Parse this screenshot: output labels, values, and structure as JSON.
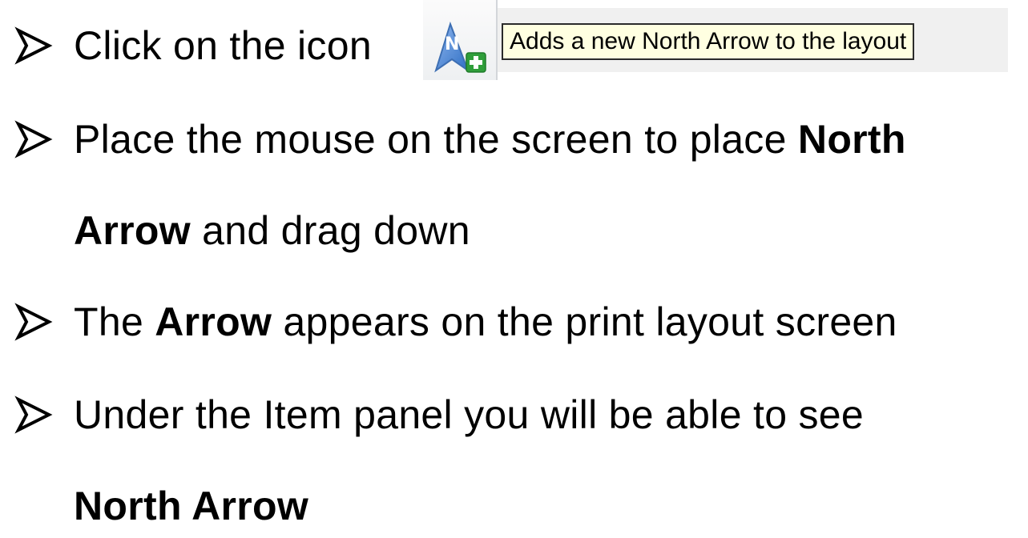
{
  "lines": [
    {
      "segments": [
        {
          "text": "Click on the icon",
          "bold": false
        }
      ]
    },
    {
      "segments": [
        {
          "text": "Place the mouse on the screen to place ",
          "bold": false
        },
        {
          "text": "North",
          "bold": true
        }
      ]
    },
    {
      "segments": [
        {
          "text": "Arrow",
          "bold": true
        },
        {
          "text": " and drag down",
          "bold": false
        }
      ]
    },
    {
      "segments": [
        {
          "text": "The ",
          "bold": false
        },
        {
          "text": "Arrow",
          "bold": true
        },
        {
          "text": " appears on the print layout screen",
          "bold": false
        }
      ]
    },
    {
      "segments": [
        {
          "text": "Under the Item panel you will be able to see",
          "bold": false
        }
      ]
    },
    {
      "segments": [
        {
          "text": "North Arrow",
          "bold": true
        }
      ]
    }
  ],
  "toolbar": {
    "icon": "add-north-arrow-icon",
    "tooltip": "Adds a new North Arrow to the layout"
  },
  "colors": {
    "icon_blue": "#5b8fd6",
    "icon_green": "#2f9e3a",
    "tooltip_bg": "#ffffe1"
  }
}
